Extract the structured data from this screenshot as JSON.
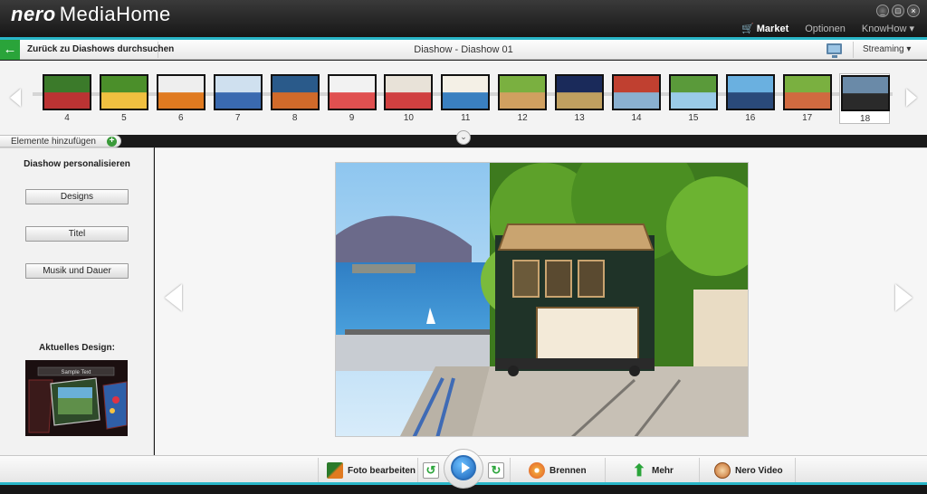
{
  "app": {
    "brand": "nero",
    "product": "MediaHome"
  },
  "window_controls": [
    "_",
    "□",
    "×"
  ],
  "top_menu": {
    "market": "Market",
    "options": "Optionen",
    "knowhow": "KnowHow ▾"
  },
  "nav": {
    "back_label": "Zurück zu Diashows durchsuchen",
    "title": "Diashow - Diashow 01",
    "streaming": "Streaming ▾"
  },
  "filmstrip": {
    "thumbs": [
      "4",
      "5",
      "6",
      "7",
      "8",
      "9",
      "10",
      "11",
      "12",
      "13",
      "14",
      "15",
      "16",
      "17",
      "18"
    ],
    "selected": "18"
  },
  "add_items_label": "Elemente hinzufügen",
  "left_panel": {
    "heading": "Diashow personalisieren",
    "buttons": {
      "designs": "Designs",
      "title": "Titel",
      "music": "Musik und Dauer"
    },
    "current_design_label": "Aktuelles Design:",
    "design_preview_text": "Sample Text"
  },
  "toolbar": {
    "edit_photo": "Foto bearbeiten",
    "burn": "Brennen",
    "more": "Mehr",
    "nero_video": "Nero Video"
  },
  "colors": {
    "accent": "#29b6c8",
    "back_green": "#2aa43a",
    "play_blue": "#1a62b8"
  }
}
